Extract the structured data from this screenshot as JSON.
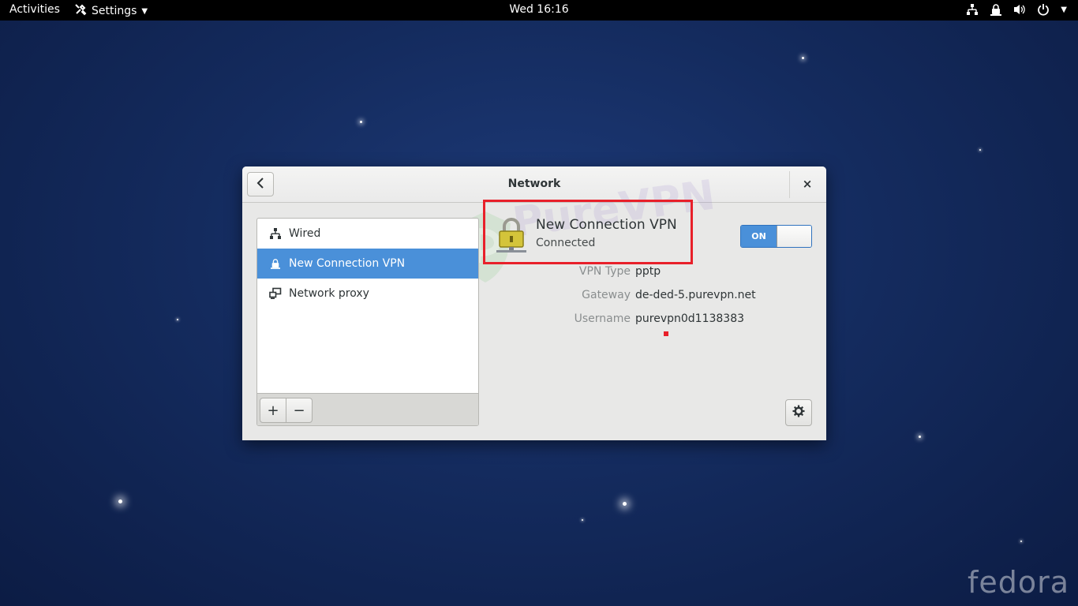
{
  "topbar": {
    "activities": "Activities",
    "app_menu": "Settings",
    "clock": "Wed 16:16"
  },
  "window": {
    "title": "Network",
    "close_glyph": "×"
  },
  "sidebar": {
    "items": [
      {
        "label": "Wired",
        "icon": "wired-network-icon",
        "selected": false
      },
      {
        "label": "New Connection VPN",
        "icon": "vpn-lock-icon",
        "selected": true
      },
      {
        "label": "Network proxy",
        "icon": "network-proxy-icon",
        "selected": false
      }
    ],
    "add_label": "+",
    "remove_label": "−"
  },
  "vpn": {
    "name": "New Connection VPN",
    "status": "Connected",
    "switch_label": "ON",
    "switch_on": true,
    "details": [
      {
        "label": "VPN Type",
        "value": "pptp"
      },
      {
        "label": "Gateway",
        "value": "de-ded-5.purevpn.net"
      },
      {
        "label": "Username",
        "value": "purevpn0d1138383"
      }
    ]
  },
  "watermark": {
    "text": "PureVPN"
  },
  "desktop": {
    "brand": "fedora"
  },
  "colors": {
    "accent": "#4a90d9",
    "highlight": "#e8202a"
  }
}
